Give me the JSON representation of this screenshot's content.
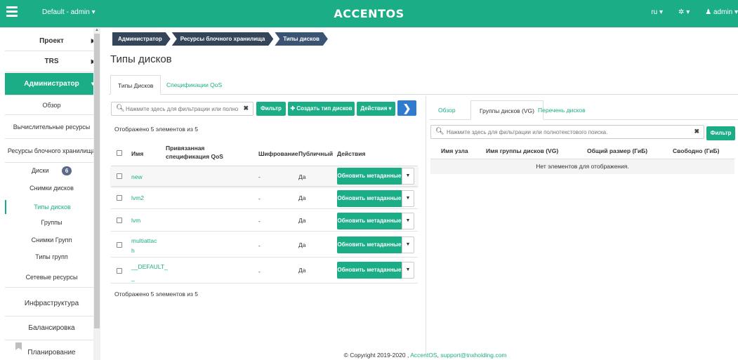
{
  "topbar": {
    "project": "Default - admin ▾",
    "brand": "ACCENTOS",
    "lang": "ru ▾",
    "settings": "✲ ▾",
    "user": "♟ admin ▾"
  },
  "sidebar": {
    "project": "Проект",
    "trs": "TRS",
    "admin": "Администратор",
    "overview": "Обзор",
    "compute": "Вычислительные ресурсы",
    "block_storage": "Ресурсы блочного хранилища",
    "disks": "Диски",
    "disks_badge": "6",
    "snapshots": "Снимки дисков",
    "disk_types": "Типы дисков",
    "groups": "Группы",
    "group_snapshots": "Снимки Групп",
    "group_types": "Типы групп",
    "network": "Сетевые ресурсы",
    "infrastructure": "Инфраструктура",
    "balancing": "Балансировка",
    "planning": "Планирование"
  },
  "breadcrumb": [
    "Администратор",
    "Ресурсы блочного хранилища",
    "Типы дисков"
  ],
  "page_title": "Типы дисков",
  "tabs": {
    "disk_types": "Типы Дисков",
    "qos": "Спецификации QoS"
  },
  "toolbar": {
    "search_placeholder": "Нажмите здесь для фильтрации или полно...",
    "filter": "Фильтр",
    "create": "✚ Создать тип дисков",
    "actions": "Действия ▾",
    "next": "❯"
  },
  "table": {
    "count_top": "Отображено 5 элементов из 5",
    "count_bottom": "Отображено 5 элементов из 5",
    "headers": {
      "name": "Имя",
      "qos": "Привязанная спецификация QoS",
      "encryption": "Шифрование",
      "public": "Публичный",
      "actions": "Действия"
    },
    "rows": [
      {
        "name": "new",
        "qos": "-",
        "public": "Да",
        "action": "Обновить метаданные"
      },
      {
        "name": "lvm2",
        "qos": "-",
        "public": "Да",
        "action": "Обновить метаданные"
      },
      {
        "name": "lvm",
        "qos": "-",
        "public": "Да",
        "action": "Обновить метаданные"
      },
      {
        "name": "multiattac h",
        "name_l1": "multiattac",
        "name_l2": "h",
        "qos": "-",
        "public": "Да",
        "action": "Обновить метаданные"
      },
      {
        "name": "__DEFAULT_ _",
        "name_l1": "__DEFAULT_",
        "name_l2": "_",
        "qos": "-",
        "public": "Да",
        "action": "Обновить метаданные"
      }
    ]
  },
  "right": {
    "tabs": {
      "overview": "Обзор",
      "vg": "Группы дисков (VG)",
      "list": "Перечень дисков"
    },
    "search_placeholder": "Нажмите здесь для фильтрации или полнотекстового поиска.",
    "filter": "Фильтр",
    "headers": {
      "node": "Имя узла",
      "vg_name": "Имя группы дисков (VG)",
      "total": "Общий размер (ГиБ)",
      "free": "Свободно (ГиБ)"
    },
    "empty": "Нет элементов для отображения."
  },
  "footer": {
    "copyright": "© Copyright 2019-2020 ,",
    "accentos": "AccentOS",
    "sep": ",",
    "email": "support@tnxholding.com"
  },
  "colors": {
    "accent": "#1bae86",
    "breadcrumb": "#34455a",
    "next_button": "#2f7bd0",
    "badge": "#5b6a8a"
  }
}
